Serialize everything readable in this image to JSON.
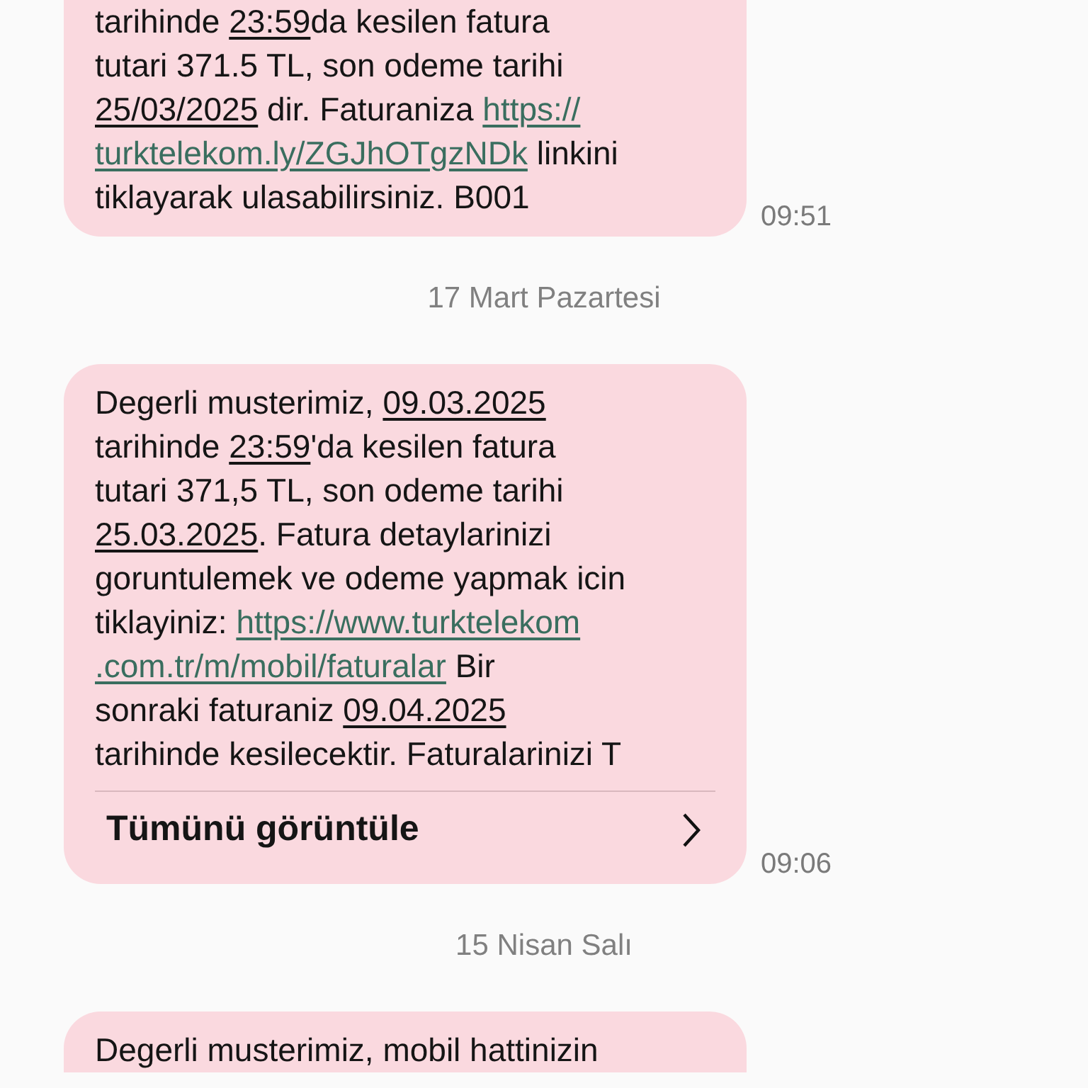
{
  "items": [
    {
      "kind": "message",
      "time": "09:51",
      "lines": [
        [
          {
            "kind": "text",
            "text": "tarihinde "
          },
          {
            "kind": "date",
            "text": "23:59"
          },
          {
            "kind": "text",
            "text": "da kesilen fatura"
          }
        ],
        [
          {
            "kind": "text",
            "text": "tutari 371.5 TL, son odeme tarihi"
          }
        ],
        [
          {
            "kind": "date",
            "text": "25/03/2025"
          },
          {
            "kind": "text",
            "text": " dir. Faturaniza "
          },
          {
            "kind": "link",
            "text": "https://"
          }
        ],
        [
          {
            "kind": "link",
            "text": "turktelekom.ly/ZGJhOTgzNDk"
          },
          {
            "kind": "text",
            "text": " linkini"
          }
        ],
        [
          {
            "kind": "text",
            "text": "tiklayarak ulasabilirsiniz. B001"
          }
        ]
      ]
    },
    {
      "kind": "date",
      "text": "17 Mart Pazartesi"
    },
    {
      "kind": "message",
      "time": "09:06",
      "expand_label": "Tümünü görüntüle",
      "lines": [
        [
          {
            "kind": "text",
            "text": "Degerli musterimiz, "
          },
          {
            "kind": "date",
            "text": "09.03.2025"
          }
        ],
        [
          {
            "kind": "text",
            "text": "tarihinde "
          },
          {
            "kind": "date",
            "text": "23:59"
          },
          {
            "kind": "text",
            "text": "'da kesilen fatura"
          }
        ],
        [
          {
            "kind": "text",
            "text": "tutari 371,5 TL, son odeme tarihi"
          }
        ],
        [
          {
            "kind": "date",
            "text": "25.03.2025"
          },
          {
            "kind": "text",
            "text": ". Fatura detaylarinizi"
          }
        ],
        [
          {
            "kind": "text",
            "text": "goruntulemek ve odeme yapmak icin"
          }
        ],
        [
          {
            "kind": "text",
            "text": "tiklayiniz: "
          },
          {
            "kind": "link",
            "text": "https://www.turktelekom"
          }
        ],
        [
          {
            "kind": "link",
            "text": ".com.tr/m/mobil/faturalar"
          },
          {
            "kind": "text",
            "text": " Bir"
          }
        ],
        [
          {
            "kind": "text",
            "text": "sonraki faturaniz "
          },
          {
            "kind": "date",
            "text": "09.04.2025"
          }
        ],
        [
          {
            "kind": "text",
            "text": "tarihinde kesilecektir. Faturalarinizi T"
          }
        ]
      ]
    },
    {
      "kind": "date",
      "text": "15 Nisan Salı"
    },
    {
      "kind": "message",
      "lines": [
        [
          {
            "kind": "text",
            "text": "Degerli musterimiz, mobil hattinizin"
          }
        ]
      ]
    }
  ]
}
